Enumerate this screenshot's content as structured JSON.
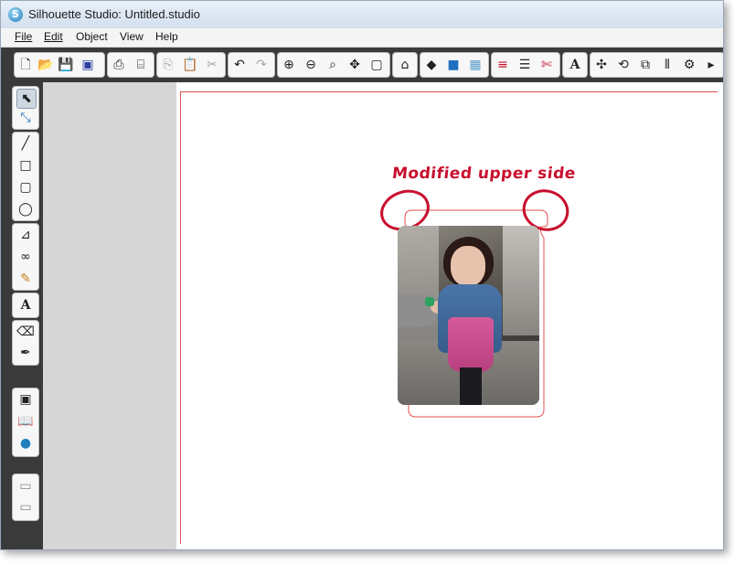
{
  "window": {
    "title": "Silhouette Studio: Untitled.studio"
  },
  "menu": {
    "items": [
      {
        "label": "File"
      },
      {
        "label": "Edit"
      },
      {
        "label": "Object"
      },
      {
        "label": "View"
      },
      {
        "label": "Help"
      }
    ]
  },
  "toolbar": {
    "icons": [
      "new-document-icon",
      "open-folder-icon",
      "save-icon",
      "save-to-library-icon",
      "print-icon",
      "print-cut-icon",
      "copy-icon",
      "paste-icon",
      "cut-icon",
      "undo-icon",
      "redo-icon",
      "zoom-in-icon",
      "zoom-out-icon",
      "zoom-area-icon",
      "pan-icon",
      "fit-page-icon",
      "home-icon",
      "fill-color-icon",
      "fill-gradient-icon",
      "fill-pattern-icon",
      "line-color-icon",
      "line-style-icon",
      "cut-style-icon",
      "text-style-icon",
      "transform-icon",
      "rotate-icon",
      "scale-icon",
      "align-icon",
      "settings-icon"
    ]
  },
  "left_tools": {
    "icons": [
      "select-icon",
      "edit-points-icon",
      "line-icon",
      "rectangle-icon",
      "rounded-rectangle-icon",
      "ellipse-icon",
      "polygon-icon",
      "curve-icon",
      "freehand-icon",
      "text-icon",
      "eraser-icon",
      "knife-icon",
      "trace-icon",
      "library-icon",
      "silhouette-store-icon",
      "panel-top-icon",
      "panel-bottom-icon"
    ]
  },
  "canvas": {
    "annotation": "Modified upper side",
    "accent_color": "#c8102e",
    "cut_line_color": "#e05050"
  }
}
